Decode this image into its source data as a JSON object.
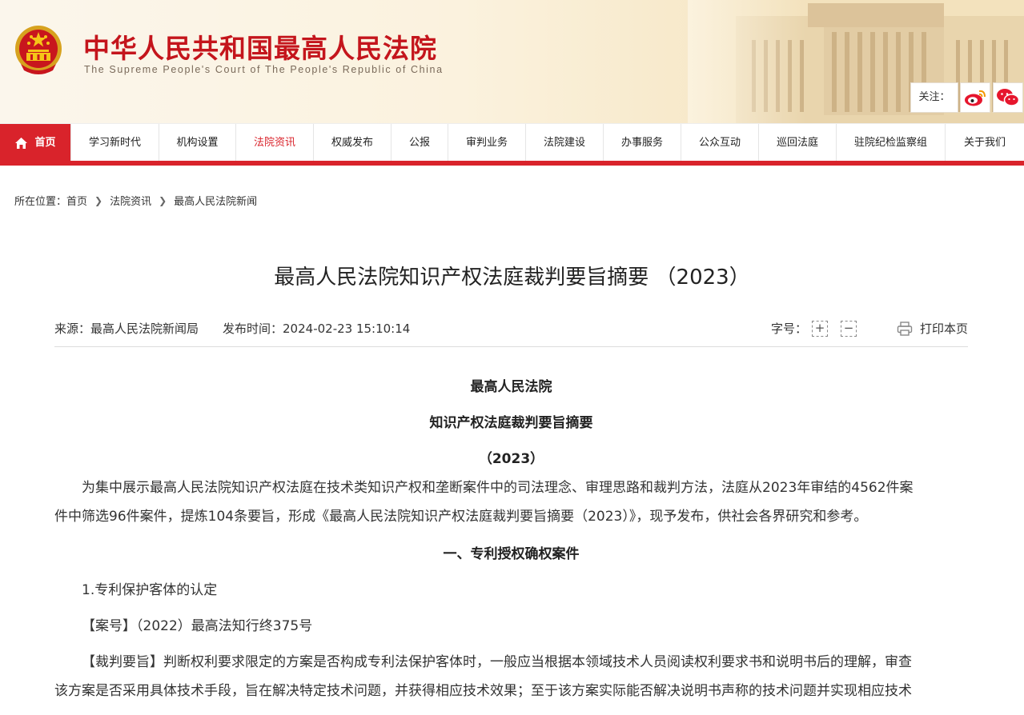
{
  "header": {
    "title": "中华人民共和国最高人民法院",
    "subtitle": "The Supreme People's Court of The People's Republic of China",
    "follow_label": "关注："
  },
  "nav": {
    "items": [
      "首页",
      "学习新时代",
      "机构设置",
      "法院资讯",
      "权威发布",
      "公报",
      "审判业务",
      "法院建设",
      "办事服务",
      "公众互动",
      "巡回法庭",
      "驻院纪检监察组",
      "关于我们"
    ],
    "active": "法院资讯"
  },
  "breadcrumb": {
    "prefix": "所在位置：",
    "items": [
      "首页",
      "法院资讯",
      "最高人民法院新闻"
    ]
  },
  "article": {
    "title": "最高人民法院知识产权法庭裁判要旨摘要 （2023）",
    "source": "来源：最高人民法院新闻局",
    "publish_time": "发布时间：2024-02-23 15:10:14",
    "font_size_label": "字号：",
    "font_increase": "+",
    "font_decrease": "−",
    "print_label": "打印本页",
    "heading1": "最高人民法院",
    "heading2": "知识产权法庭裁判要旨摘要",
    "heading3": "（2023）",
    "intro_line1": "为集中展示最高人民法院知识产权法庭在技术类知识产权和垄断案件中的司法理念、审理思路和裁判方法，法庭从2023年审结的4562件案",
    "intro_line2": "件中筛选96件案件，提炼104条要旨，形成《最高人民法院知识产权法庭裁判要旨摘要（2023）》，现予发布，供社会各界研究和参考。",
    "section1": "一、专利授权确权案件",
    "item1": "1.专利保护客体的认定",
    "case_no": "【案号】（2022）最高法知行终375号",
    "gist_line1": "【裁判要旨】判断权利要求限定的方案是否构成专利法保护客体时，一般应当根据本领域技术人员阅读权利要求书和说明书后的理解，审查",
    "gist_line2": "该方案是否采用具体技术手段，旨在解决特定技术问题，并获得相应技术效果；至于该方案实际能否解决说明书声称的技术问题并实现相应技术"
  },
  "colors": {
    "brand_red": "#d9232b",
    "title_red": "#c4151c"
  }
}
